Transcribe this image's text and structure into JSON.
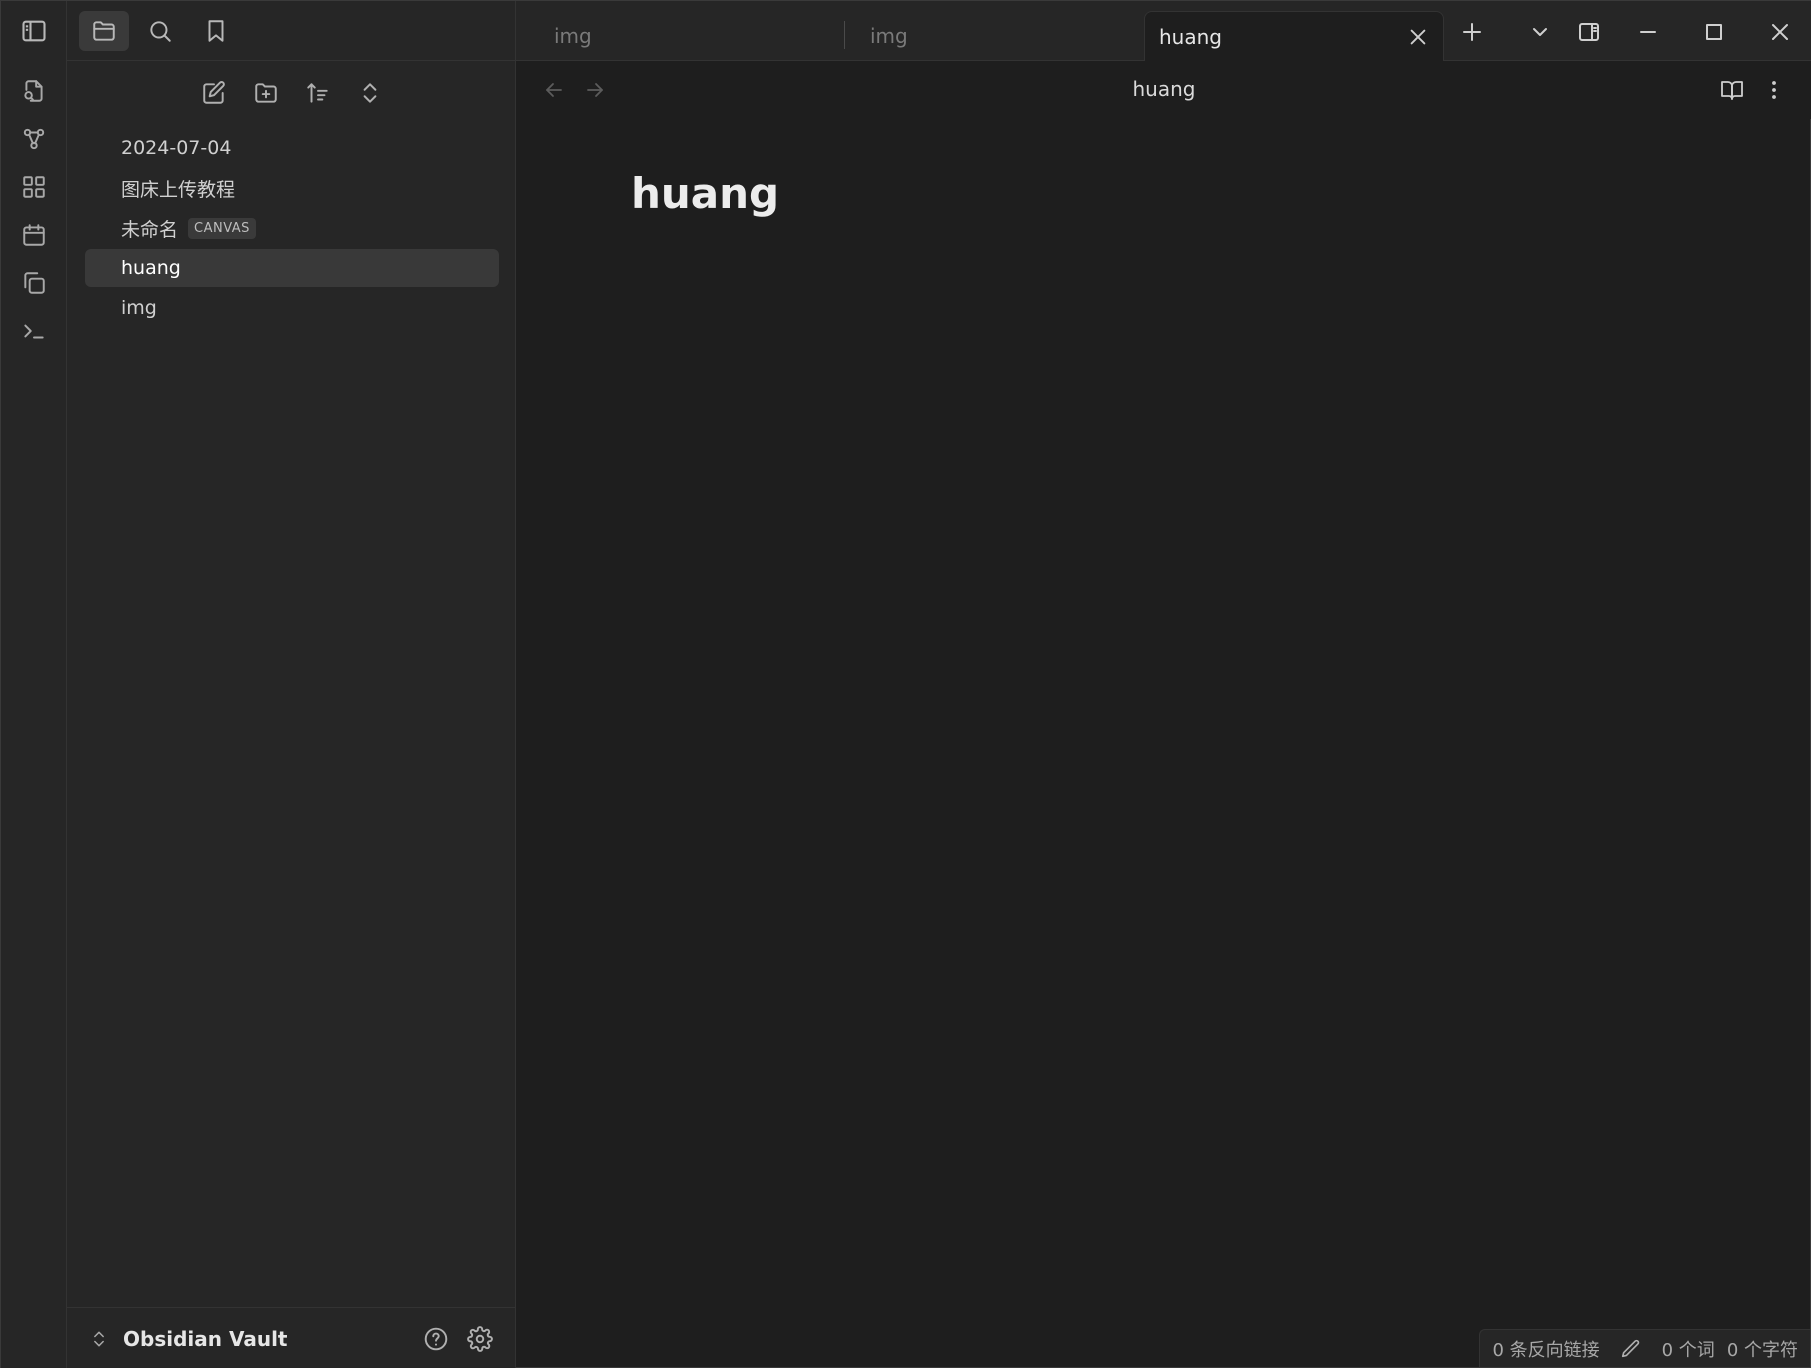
{
  "tabs": [
    {
      "label": "img",
      "active": false
    },
    {
      "label": "img",
      "active": false
    },
    {
      "label": "huang",
      "active": true
    }
  ],
  "sidebar": {
    "header_icons": [
      "sidebar-toggle-icon",
      "folder-icon",
      "search-icon",
      "bookmark-icon"
    ],
    "nav_actions": [
      "new-note-icon",
      "new-folder-icon",
      "sort-icon",
      "collapse-icon"
    ],
    "items": [
      {
        "label": "2024-07-04",
        "badge": ""
      },
      {
        "label": "图床上传教程",
        "badge": ""
      },
      {
        "label": "未命名",
        "badge": "CANVAS"
      },
      {
        "label": "huang",
        "badge": "",
        "active": true
      },
      {
        "label": "img",
        "badge": ""
      }
    ],
    "vault_name": "Obsidian Vault"
  },
  "ribbon_icons": [
    "file-search-icon",
    "graph-icon",
    "blocks-icon",
    "calendar-icon",
    "copy-icon",
    "terminal-icon"
  ],
  "view_header": {
    "title": "huang"
  },
  "note": {
    "title": "huang"
  },
  "status": {
    "backlinks": "0 条反向链接",
    "words": "0 个词",
    "chars": "0 个字符"
  },
  "colors": {
    "background": "#1e1e1e",
    "panel": "#262626",
    "active_item": "#393939",
    "text": "#dadada"
  }
}
